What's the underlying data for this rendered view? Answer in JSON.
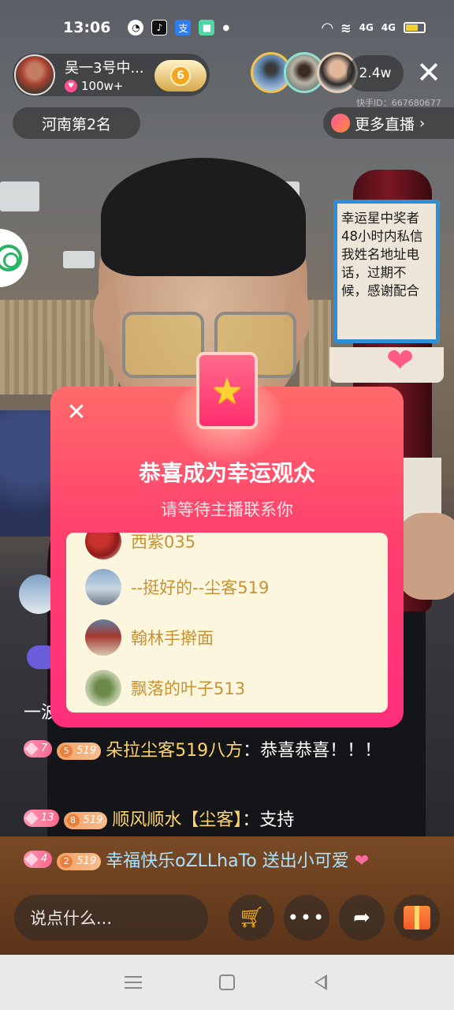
{
  "status_bar": {
    "time": "13:06",
    "signal_1": "4G",
    "signal_2": "4G"
  },
  "host": {
    "name": "吴一3号中...",
    "likes": "100w+",
    "level": "6"
  },
  "viewers": {
    "count": "2.4w"
  },
  "uid_text": "快手ID：667680677",
  "rank": "河南第2名",
  "more_live": "更多直播",
  "notice": "幸运星中奖者48小时内私信我姓名地址电话，过期不候，感谢配合",
  "lucky_dialog": {
    "title": "恭喜成为幸运观众",
    "subtitle": "请等待主播联系你",
    "winners": [
      {
        "name": "西紫035"
      },
      {
        "name": "--挺好的--尘客519"
      },
      {
        "name": "翰林手擀面"
      },
      {
        "name": "飘落的叶子513"
      }
    ]
  },
  "chat": {
    "fragment": "一波",
    "messages": [
      {
        "level": "7",
        "fan_level": "5",
        "fan_tag": "519",
        "user": "朵拉尘客519八方",
        "text": "：恭喜恭喜！！！"
      },
      {
        "level": "13",
        "fan_level": "8",
        "fan_tag": "519",
        "user": "顺风顺水【尘客】",
        "text": "：支持"
      },
      {
        "level": "4",
        "fan_level": "2",
        "fan_tag": "519",
        "user": "幸福快乐oZLLhaTo",
        "text": "送出小可爱"
      }
    ]
  },
  "bottom_bar": {
    "input_placeholder": "说点什么..."
  },
  "colors": {
    "dialog_top": "#ff6a6a",
    "dialog_bottom": "#ff2e7c",
    "winner_text": "#c79234",
    "username": "#ffd56b"
  }
}
